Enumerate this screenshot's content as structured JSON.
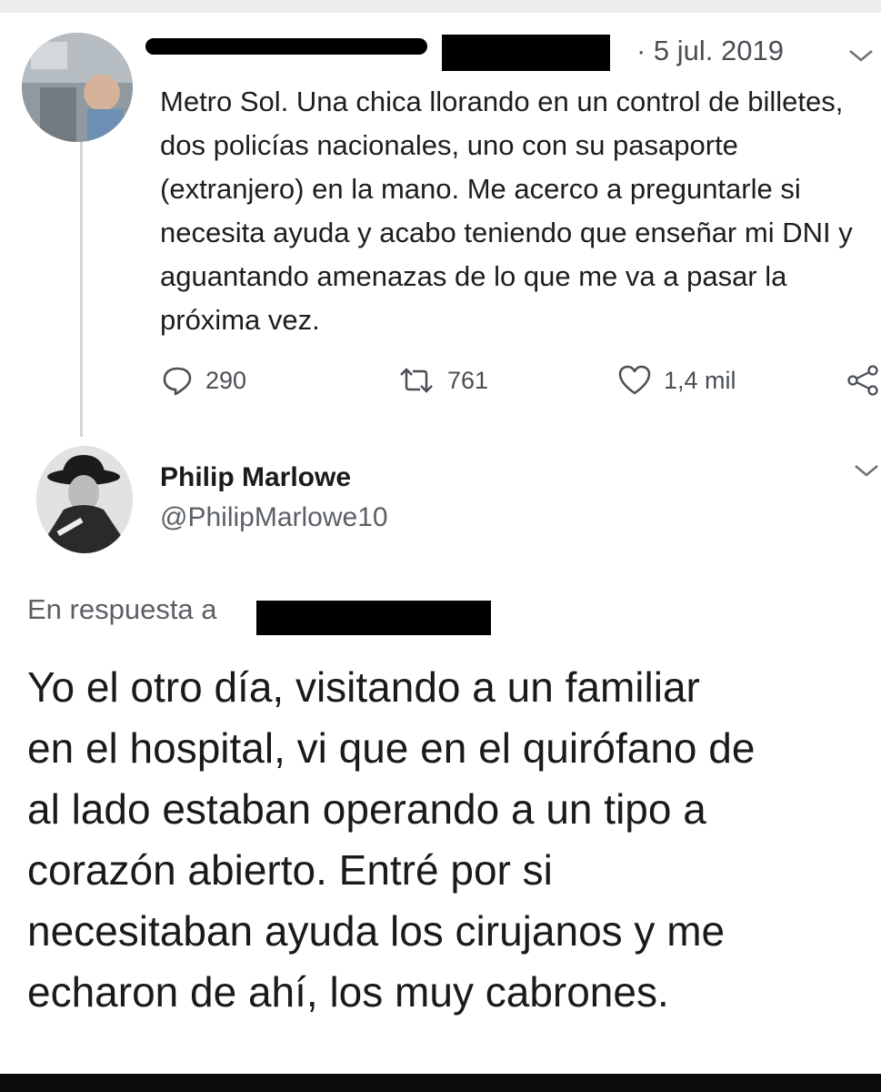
{
  "tweet": {
    "date": "· 5 jul. 2019",
    "text": "Metro Sol. Una chica llorando en un control de billetes, dos policías nacionales, uno con su pasaporte (extranjero) en la mano. Me acerco a preguntarle si necesita ayuda y acabo teniendo que enseñar mi DNI y aguantando amenazas de lo que me va a pasar la próxima vez.",
    "actions": {
      "replies": "290",
      "retweets": "761",
      "likes": "1,4 mil"
    },
    "icons": [
      "avatar",
      "chevron-down-icon",
      "reply-icon",
      "retweet-icon",
      "like-icon",
      "share-icon"
    ]
  },
  "reply": {
    "author_name": "Philip Marlowe",
    "author_handle": "@PhilipMarlowe10",
    "in_reply_to_label": "En respuesta a",
    "text": "Yo el otro día, visitando a un familiar\nen el hospital, vi que en el quirófano de\nal lado estaban operando a un tipo a\ncorazón abierto. Entré por si\nnecesitaban ayuda los cirujanos y me\necharon de ahí, los muy cabrones."
  },
  "colors": {
    "text": "#1d1d1d",
    "secondary": "#5b6066",
    "thread_line": "#cfd6dc",
    "redaction": "#000000"
  }
}
